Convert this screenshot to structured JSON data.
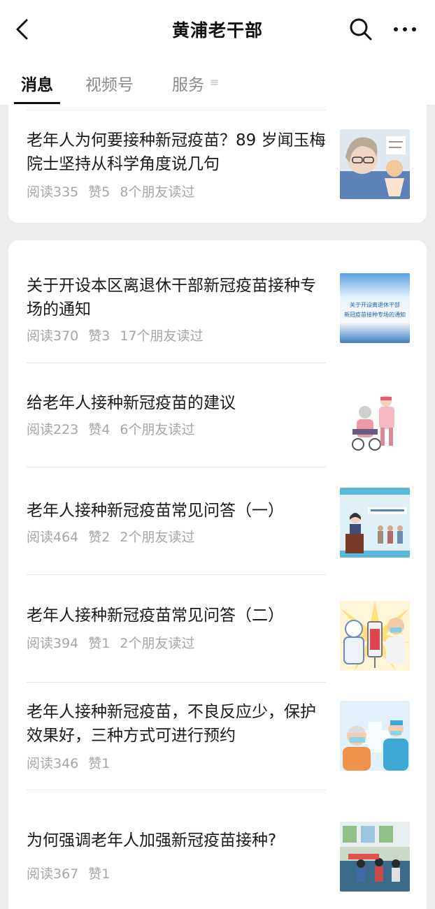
{
  "header": {
    "title": "黄浦老干部",
    "back_icon": "chevron-left-icon",
    "search_icon": "search-icon",
    "more_icon": "more-dots-icon"
  },
  "tabs": [
    {
      "label": "消息",
      "active": true
    },
    {
      "label": "视频号",
      "active": false
    },
    {
      "label": "服务",
      "active": false
    }
  ],
  "tab_more_glyph": "≡",
  "articles": [
    {
      "title": "老年人为何要接种新冠疫苗？89 岁闻玉梅院士坚持从科学角度说几句",
      "reads": "阅读335",
      "likes": "赞5",
      "friends": "8个朋友读过"
    },
    {
      "title": "关于开设本区离退休干部新冠疫苗接种专场的通知",
      "reads": "阅读370",
      "likes": "赞3",
      "friends": "17个朋友读过",
      "thumb_text": [
        "关于开设离退休干部",
        "新冠疫苗接种专场的通知"
      ]
    },
    {
      "title": "给老年人接种新冠疫苗的建议",
      "reads": "阅读223",
      "likes": "赞4",
      "friends": "6个朋友读过"
    },
    {
      "title": "老年人接种新冠疫苗常见问答（一）",
      "reads": "阅读464",
      "likes": "赞2",
      "friends": "2个朋友读过"
    },
    {
      "title": "老年人接种新冠疫苗常见问答（二）",
      "reads": "阅读394",
      "likes": "赞1",
      "friends": "2个朋友读过"
    },
    {
      "title": "老年人接种新冠疫苗，不良反应少，保护效果好，三种方式可进行预约",
      "reads": "阅读346",
      "likes": "赞1",
      "friends": ""
    },
    {
      "title": "为何强调老年人加强新冠疫苗接种?",
      "reads": "阅读367",
      "likes": "赞1",
      "friends": ""
    }
  ]
}
